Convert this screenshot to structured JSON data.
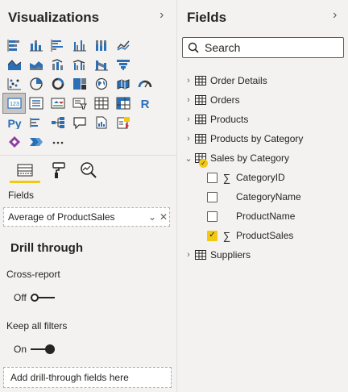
{
  "visualizations": {
    "title": "Visualizations",
    "collapse_icon": "chevron-right-icon",
    "gallery_rows": [
      [
        "stacked-bar-chart",
        "stacked-column-chart",
        "clustered-bar-chart",
        "clustered-column-chart",
        "100-percent-stacked-bar-chart",
        "line-chart"
      ],
      [
        "area-chart",
        "stacked-area-chart",
        "line-and-stacked-column-chart",
        "line-and-clustered-column-chart",
        "ribbon-chart",
        "funnel-chart"
      ],
      [
        "scatter-chart",
        "pie-chart",
        "donut-chart",
        "treemap",
        "map",
        "gauge"
      ],
      [
        "card",
        "multi-row-card",
        "kpi",
        "slicer",
        "table",
        "matrix",
        "r-script-visual"
      ],
      [
        "python-visual",
        "key-influencers",
        "decomposition-tree",
        "qa-visual",
        "smart-narrative",
        "paginated-report"
      ],
      [
        "power-apps",
        "power-automate",
        "more-visuals"
      ]
    ],
    "selected_visual": "card",
    "tabs": [
      "fields-tab",
      "format-tab",
      "analytics-tab"
    ],
    "active_tab": "fields-tab",
    "fields_label": "Fields",
    "well_value": "Average of ProductSales",
    "drill_through": {
      "heading": "Drill through",
      "cross_report_label": "Cross-report",
      "cross_report_state": "Off",
      "keep_filters_label": "Keep all filters",
      "keep_filters_state": "On",
      "drop_placeholder": "Add drill-through fields here"
    }
  },
  "fields": {
    "title": "Fields",
    "collapse_icon": "chevron-right-icon",
    "search_placeholder": "Search",
    "tables": [
      {
        "name": "Order Details",
        "expanded": false
      },
      {
        "name": "Orders",
        "expanded": false
      },
      {
        "name": "Products",
        "expanded": false
      },
      {
        "name": "Products by Category",
        "expanded": false
      },
      {
        "name": "Sales by Category",
        "expanded": true,
        "has_selection": true
      },
      {
        "name": "Suppliers",
        "expanded": false
      }
    ],
    "sales_by_category_fields": [
      {
        "name": "CategoryID",
        "sigma": true,
        "checked": false
      },
      {
        "name": "CategoryName",
        "sigma": false,
        "checked": false
      },
      {
        "name": "ProductName",
        "sigma": false,
        "checked": false
      },
      {
        "name": "ProductSales",
        "sigma": true,
        "checked": true
      }
    ],
    "sigma_glyph": "∑",
    "check_glyph": "✓",
    "colors": {
      "accent": "#f2c811",
      "pane_bg": "#f3f2f1",
      "text": "#252423",
      "icon_blue": "#2b6fb6"
    }
  }
}
